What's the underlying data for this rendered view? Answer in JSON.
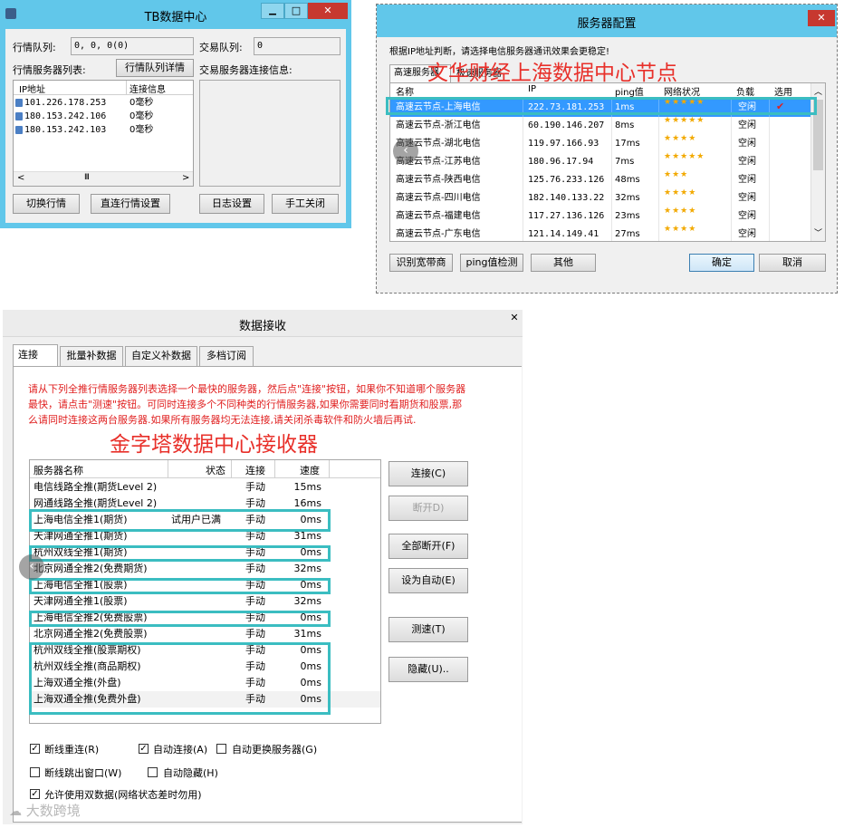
{
  "tb": {
    "title": "TB数据中心",
    "minimize": "▁",
    "maximize": "□",
    "close": "✕",
    "queue_label": "行情队列:",
    "queue_value": "0, 0, 0(0)",
    "trade_queue_label": "交易队列:",
    "trade_queue_value": "0",
    "server_list_label": "行情服务器列表:",
    "queue_detail_button": "行情队列详情",
    "trade_conn_label": "交易服务器连接信息:",
    "col_ip": "IP地址",
    "col_conn": "连接信息",
    "rows": [
      {
        "ip": "101.226.178.253",
        "conn": "0毫秒"
      },
      {
        "ip": "180.153.242.106",
        "conn": "0毫秒"
      },
      {
        "ip": "180.153.242.103",
        "conn": "0毫秒"
      }
    ],
    "scroll_grip": "III",
    "btn_switch": "切换行情",
    "btn_direct": "直连行情设置",
    "btn_log": "日志设置",
    "btn_manual_close": "手工关闭"
  },
  "srv": {
    "title": "服务器配置",
    "close": "✕",
    "note": "根据IP地址判断，请选择电信服务器通讯效果会更稳定!",
    "tab1": "高速服务器",
    "tab2": "极速服务器",
    "overlay": "文华财经上海数据中心节点",
    "cols": [
      "名称",
      "IP",
      "ping值",
      "网络状况",
      "负载",
      "选用"
    ],
    "rows": [
      {
        "name": "高速云节点-上海电信",
        "ip": "222.73.181.253",
        "ping": "1ms",
        "stars": "★★★★★",
        "load": "空闲",
        "sel": "✔"
      },
      {
        "name": "高速云节点-浙江电信",
        "ip": "60.190.146.207",
        "ping": "8ms",
        "stars": "★★★★★",
        "load": "空闲",
        "sel": ""
      },
      {
        "name": "高速云节点-湖北电信",
        "ip": "119.97.166.93",
        "ping": "17ms",
        "stars": "★★★★",
        "load": "空闲",
        "sel": ""
      },
      {
        "name": "高速云节点-江苏电信",
        "ip": "180.96.17.94",
        "ping": "7ms",
        "stars": "★★★★★",
        "load": "空闲",
        "sel": ""
      },
      {
        "name": "高速云节点-陕西电信",
        "ip": "125.76.233.126",
        "ping": "48ms",
        "stars": "★★★",
        "load": "空闲",
        "sel": ""
      },
      {
        "name": "高速云节点-四川电信",
        "ip": "182.140.133.22",
        "ping": "32ms",
        "stars": "★★★★",
        "load": "空闲",
        "sel": ""
      },
      {
        "name": "高速云节点-福建电信",
        "ip": "117.27.136.126",
        "ping": "23ms",
        "stars": "★★★★",
        "load": "空闲",
        "sel": ""
      },
      {
        "name": "高速云节点-广东电信",
        "ip": "121.14.149.41",
        "ping": "27ms",
        "stars": "★★★★",
        "load": "空闲",
        "sel": ""
      }
    ],
    "btn_identify": "识别宽带商",
    "btn_ping": "ping值检测",
    "btn_other": "其他",
    "btn_ok": "确定",
    "btn_cancel": "取消"
  },
  "recv": {
    "title": "数据接收",
    "close": "✕",
    "tabs": [
      "连接",
      "批量补数据",
      "自定义补数据",
      "多档订阅"
    ],
    "instructions": "请从下列全推行情服务器列表选择一个最快的服务器，然后点\"连接\"按钮，如果你不知道哪个服务器最快，请点击\"测速\"按钮。可同时连接多个不同种类的行情服务器,如果你需要同时看期货和股票,那么请同时连接这两台服务器.如果所有服务器均无法连接,请关闭杀毒软件和防火墙后再试.",
    "overlay": "金字塔数据中心接收器",
    "cols": [
      "服务器名称",
      "状态",
      "连接",
      "速度"
    ],
    "rows": [
      {
        "name": "电信线路全推(期货Level 2)",
        "status": "",
        "conn": "手动",
        "speed": "15ms"
      },
      {
        "name": "网通线路全推(期货Level 2)",
        "status": "",
        "conn": "手动",
        "speed": "16ms"
      },
      {
        "name": "上海电信全推1(期货)",
        "status": "试用户已满",
        "conn": "手动",
        "speed": "0ms"
      },
      {
        "name": "天津网通全推1(期货)",
        "status": "",
        "conn": "手动",
        "speed": "31ms"
      },
      {
        "name": "杭州双线全推1(期货)",
        "status": "",
        "conn": "手动",
        "speed": "0ms"
      },
      {
        "name": "北京网通全推2(免费期货)",
        "status": "",
        "conn": "手动",
        "speed": "32ms"
      },
      {
        "name": "上海电信全推1(股票)",
        "status": "",
        "conn": "手动",
        "speed": "0ms"
      },
      {
        "name": "天津网通全推1(股票)",
        "status": "",
        "conn": "手动",
        "speed": "32ms"
      },
      {
        "name": "上海电信全推2(免费股票)",
        "status": "",
        "conn": "手动",
        "speed": "0ms"
      },
      {
        "name": "北京网通全推2(免费股票)",
        "status": "",
        "conn": "手动",
        "speed": "31ms"
      },
      {
        "name": "杭州双线全推(股票期权)",
        "status": "",
        "conn": "手动",
        "speed": "0ms"
      },
      {
        "name": "杭州双线全推(商品期权)",
        "status": "",
        "conn": "手动",
        "speed": "0ms"
      },
      {
        "name": "上海双通全推(外盘)",
        "status": "",
        "conn": "手动",
        "speed": "0ms"
      },
      {
        "name": "上海双通全推(免费外盘)",
        "status": "",
        "conn": "手动",
        "speed": "0ms"
      }
    ],
    "btn_connect": "连接(C)",
    "btn_disconnect": "断开D)",
    "btn_disconnect_all": "全部断开(F)",
    "btn_set_auto": "设为自动(E)",
    "btn_speedtest": "测速(T)",
    "btn_hide": "隐藏(U)..",
    "opt_reconnect": "断线重连(R)",
    "opt_auto_connect": "自动连接(A)",
    "opt_auto_switch": "自动更换服务器(G)",
    "opt_popup": "断线跳出窗口(W)",
    "opt_auto_hide": "自动隐藏(H)",
    "opt_dual": "允许使用双数据(网络状态差时勿用)",
    "checked_mark": "✓"
  },
  "watermark": "大数跨境",
  "colors": {
    "title_bar": "#61c7ea",
    "close_red": "#c7382f",
    "highlight_cyan": "#3bbdc1",
    "selected_row": "#3399ff",
    "instruction_red": "#e02020",
    "overlay_red": "#e8302a",
    "star_gold": "#f2a900"
  }
}
